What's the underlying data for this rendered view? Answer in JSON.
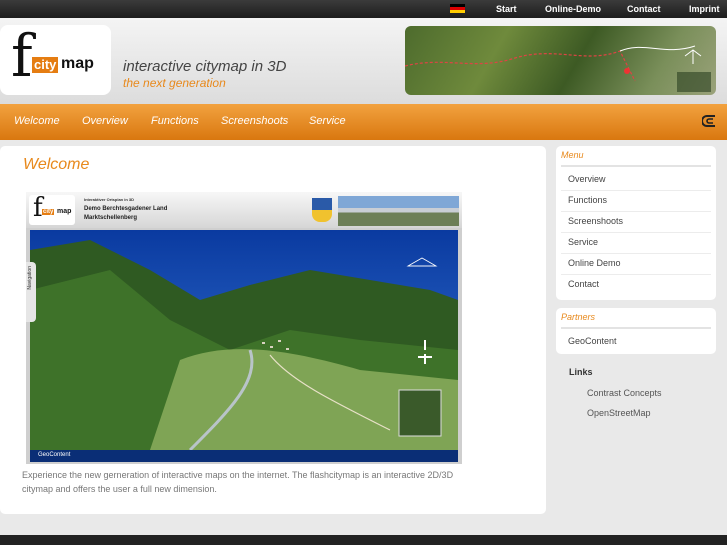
{
  "topbar": {
    "flag_icon": "german-flag-icon",
    "links": [
      "Start",
      "Online-Demo",
      "Contact",
      "Imprint"
    ]
  },
  "header": {
    "logo_f": "f",
    "logo_city": "city",
    "logo_map": "map",
    "tagline": "interactive citymap in 3D",
    "subtagline": "the next generation"
  },
  "mainnav": {
    "items": [
      "Welcome",
      "Overview",
      "Functions",
      "Screenshoots",
      "Service"
    ],
    "brand_icon": "contrast-concepts-logo-icon"
  },
  "content": {
    "title": "Welcome",
    "screenshot": {
      "logo_f": "f",
      "logo_city": "city",
      "logo_map": "map",
      "line1": "Interaktiver Ortsplan in 3D",
      "line2": "Demo Berchtesgadener Land",
      "line3": "Marktschellenberg",
      "nav_tab": "Navigation",
      "footer_label": "GeoContent"
    },
    "caption": "Experience the new gerneration of interactive maps on the internet. The flashcitymap is an interactive 2D/3D citymap and offers the user a full new dimension."
  },
  "sidebar": {
    "menu_title": "Menu",
    "menu_items": [
      "Overview",
      "Functions",
      "Screenshoots",
      "Service",
      "Online Demo",
      "Contact"
    ],
    "partners_title": "Partners",
    "partners_items": [
      "GeoContent"
    ],
    "links_title": "Links",
    "links": [
      "Contrast Concepts",
      "OpenStreetMap"
    ]
  },
  "colors": {
    "accent": "#e8891c",
    "nav_orange": "#e88a1e",
    "topbar": "#2a2a2a"
  }
}
